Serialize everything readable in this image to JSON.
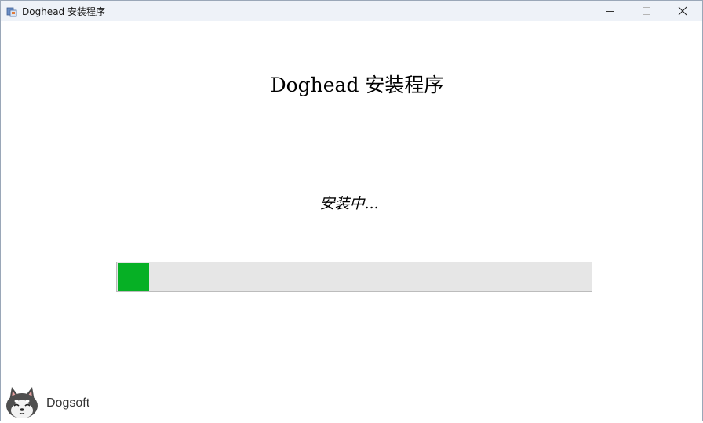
{
  "window": {
    "title": "Doghead 安装程序",
    "app_icon": "installer-icon",
    "controls": {
      "minimize_icon": "minimize-icon",
      "maximize_icon": "maximize-icon",
      "close_icon": "close-icon"
    }
  },
  "main": {
    "heading": "Doghead 安装程序",
    "status": "安装中...",
    "progress": {
      "fraction": 0.067,
      "fill_color": "#06b025",
      "track_color": "#e6e6e6"
    }
  },
  "footer": {
    "logo_icon": "dog-logo-icon",
    "brand": "Dogsoft"
  }
}
